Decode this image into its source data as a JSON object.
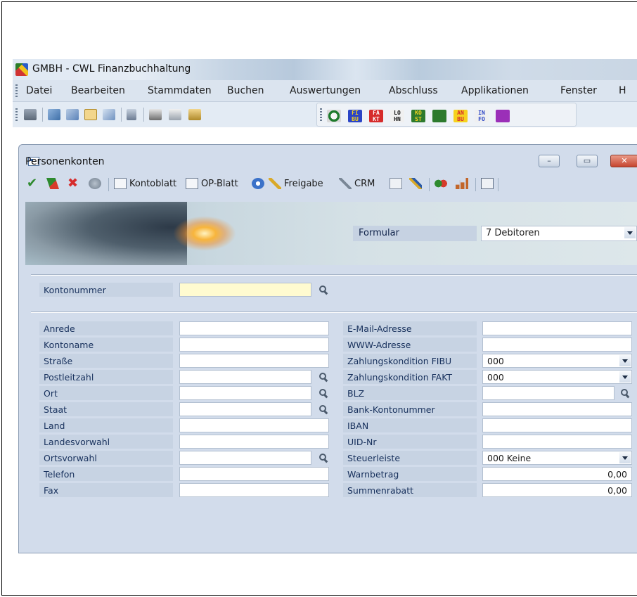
{
  "app": {
    "title": "GMBH - CWL Finanzbuchhaltung"
  },
  "menu": [
    "Datei",
    "Bearbeiten",
    "Stammdaten",
    "Buchen",
    "Auswertungen",
    "Abschluss",
    "Applikationen",
    "Fenster",
    "H"
  ],
  "modules": [
    {
      "label": "FI\nBU",
      "icon": "fibu-module-icon",
      "bg": "#2a44c6",
      "fg": "#f6d21e"
    },
    {
      "label": "FA\nKT",
      "icon": "fakt-module-icon",
      "bg": "#d62c2c",
      "fg": "#ffffff"
    },
    {
      "label": "LO\nHN",
      "icon": "lohn-module-icon",
      "bg": "#f0f0f0",
      "fg": "#111111"
    },
    {
      "label": "KO\nST",
      "icon": "kost-module-icon",
      "bg": "#2d7a2d",
      "fg": "#f6d21e"
    },
    {
      "label": "",
      "icon": "chart-module-icon",
      "bg": "#2d7a2d",
      "fg": "#c03030"
    },
    {
      "label": "AN\nBU",
      "icon": "anbu-module-icon",
      "bg": "#f6d21e",
      "fg": "#d62c2c"
    },
    {
      "label": "IN\nFO",
      "icon": "info-module-icon",
      "bg": "#f0f0f0",
      "fg": "#2a44c6"
    },
    {
      "label": "",
      "icon": "grid-module-icon",
      "bg": "#9b2fb8",
      "fg": "#ffffff"
    }
  ],
  "window": {
    "title": "Personenkonten",
    "minimize": "–",
    "maximize": "▭",
    "close": "✕"
  },
  "inner_toolbar": {
    "kontoblatt": "Kontoblatt",
    "op_blatt": "OP-Blatt",
    "freigabe": "Freigabe",
    "crm": "CRM"
  },
  "formular": {
    "label": "Formular",
    "value": "7  Debitoren"
  },
  "kontonummer": {
    "label": "Kontonummer",
    "value": ""
  },
  "left_fields": [
    {
      "label": "Anrede",
      "value": "",
      "lookup": false
    },
    {
      "label": "Kontoname",
      "value": "",
      "lookup": false
    },
    {
      "label": "Straße",
      "value": "",
      "lookup": false
    },
    {
      "label": "Postleitzahl",
      "value": "",
      "lookup": true
    },
    {
      "label": "Ort",
      "value": "",
      "lookup": true
    },
    {
      "label": "Staat",
      "value": "",
      "lookup": true
    },
    {
      "label": "Land",
      "value": "",
      "lookup": false
    },
    {
      "label": "Landesvorwahl",
      "value": "",
      "lookup": false
    },
    {
      "label": "Ortsvorwahl",
      "value": "",
      "lookup": true
    },
    {
      "label": "Telefon",
      "value": "",
      "lookup": false
    },
    {
      "label": "Fax",
      "value": "",
      "lookup": false
    }
  ],
  "right_fields": [
    {
      "label": "E-Mail-Adresse",
      "value": "",
      "type": "text"
    },
    {
      "label": "WWW-Adresse",
      "value": "",
      "type": "text"
    },
    {
      "label": "Zahlungskondition FIBU",
      "value": "000",
      "type": "select"
    },
    {
      "label": "Zahlungskondition FAKT",
      "value": "000",
      "type": "select"
    },
    {
      "label": "BLZ",
      "value": "",
      "type": "lookup"
    },
    {
      "label": "Bank-Kontonummer",
      "value": "",
      "type": "text"
    },
    {
      "label": "IBAN",
      "value": "",
      "type": "text"
    },
    {
      "label": "UID-Nr",
      "value": "",
      "type": "text"
    },
    {
      "label": "Steuerleiste",
      "value": "000 Keine",
      "type": "select"
    },
    {
      "label": "Warnbetrag",
      "value": "0,00",
      "type": "number"
    },
    {
      "label": "Summenrabatt",
      "value": "0,00",
      "type": "number"
    }
  ]
}
